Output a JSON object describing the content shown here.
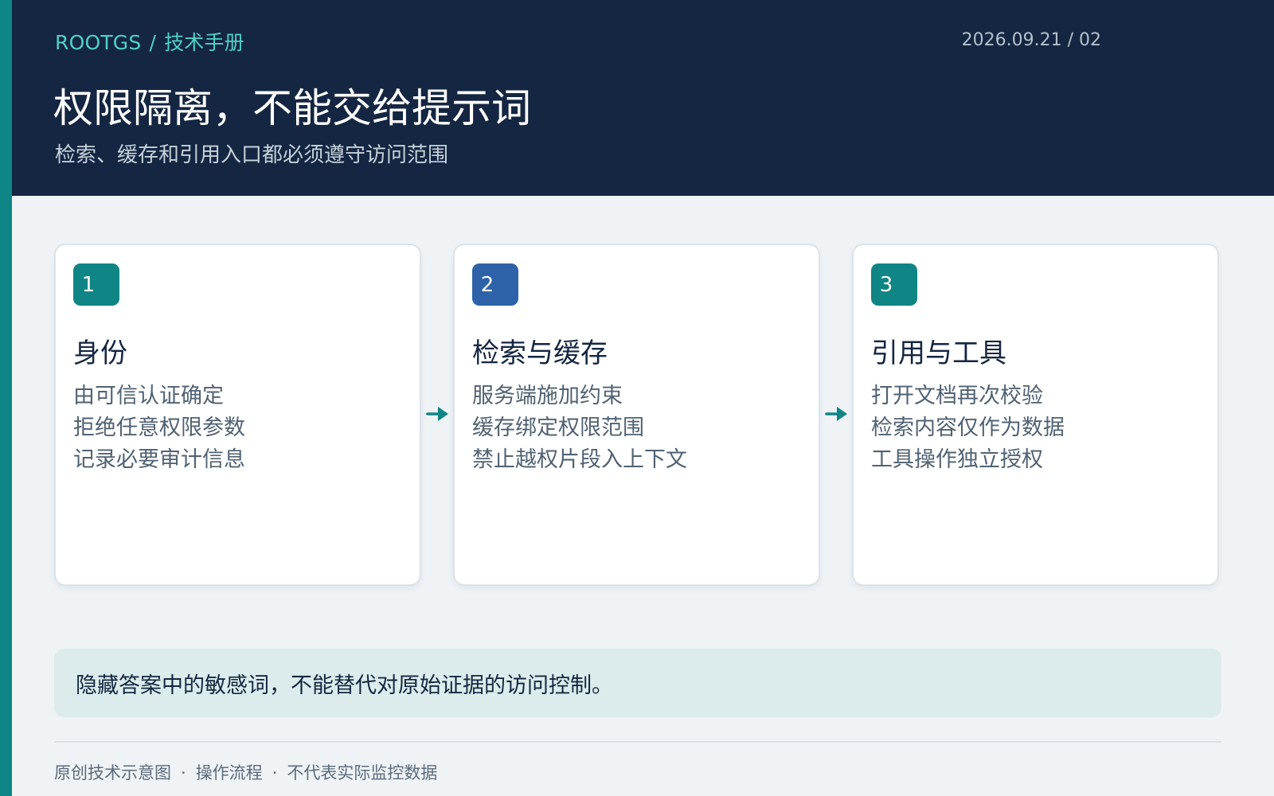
{
  "header": {
    "brand": "ROOTGS",
    "separator": "/",
    "section": "技术手册",
    "date_page": "2026.09.21 / 02",
    "title": "权限隔离，不能交给提示词",
    "subtitle": "检索、缓存和引用入口都必须遵守访问范围"
  },
  "steps": [
    {
      "number": "1",
      "title": "身份",
      "lines": [
        "由可信认证确定",
        "拒绝任意权限参数",
        "记录必要审计信息"
      ]
    },
    {
      "number": "2",
      "title": "检索与缓存",
      "lines": [
        "服务端施加约束",
        "缓存绑定权限范围",
        "禁止越权片段入上下文"
      ]
    },
    {
      "number": "3",
      "title": "引用与工具",
      "lines": [
        "打开文档再次校验",
        "检索内容仅作为数据",
        "工具操作独立授权"
      ]
    }
  ],
  "note": "隐藏答案中的敏感词，不能替代对原始证据的访问控制。",
  "footer": {
    "items": [
      "原创技术示意图",
      "操作流程",
      "不代表实际监控数据"
    ],
    "separator": "·"
  },
  "colors": {
    "header_bg": "#142641",
    "accent_teal": "#0f8585",
    "badge_blue": "#2d62a8",
    "page_bg": "#eff3f6",
    "note_bg": "#dcecec"
  },
  "icons": {
    "arrow": "arrow-right-icon"
  }
}
